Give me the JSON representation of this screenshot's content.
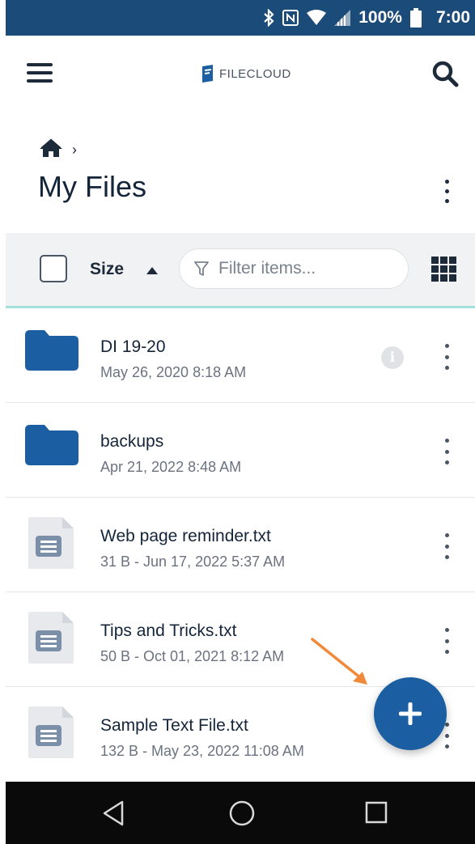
{
  "status_bar": {
    "battery_text": "100%",
    "time": "7:00",
    "icons": [
      "bluetooth-icon",
      "nfc-icon",
      "wifi-icon",
      "cell-signal-icon",
      "battery-icon"
    ]
  },
  "app_bar": {
    "logo_text": "FILECLOUD",
    "icons": [
      "menu-icon",
      "filecloud-logo-icon",
      "search-icon"
    ]
  },
  "breadcrumb": {
    "home_icon": "home-icon",
    "separator": "›"
  },
  "page": {
    "title": "My Files"
  },
  "toolbar": {
    "sort_label": "Size",
    "sort_direction": "ascending",
    "filter_placeholder": "Filter items...",
    "accent_color": "#a4e0da"
  },
  "files": [
    {
      "type": "folder",
      "name": "DI 19-20",
      "meta": "May 26, 2020 8:18 AM",
      "has_info": true
    },
    {
      "type": "folder",
      "name": "backups",
      "meta": "Apr 21, 2022 8:48 AM",
      "has_info": false
    },
    {
      "type": "file",
      "name": "Web page reminder.txt",
      "meta": "31 B - Jun 17, 2022 5:37 AM",
      "has_info": false
    },
    {
      "type": "file",
      "name": "Tips and Tricks.txt",
      "meta": "50 B - Oct 01, 2021 8:12 AM",
      "has_info": false
    },
    {
      "type": "file",
      "name": "Sample Text File.txt",
      "meta": "132 B - May 23, 2022 11:08 AM",
      "has_info": false
    }
  ],
  "info_glyph": "i",
  "fab": {
    "icon": "plus-icon",
    "color": "#1b5fa2"
  },
  "annotation": {
    "icon": "orange-arrow-icon",
    "color": "#f08a3a"
  },
  "nav_bar": {
    "icons": [
      "back-icon",
      "home-circle-icon",
      "recents-icon"
    ]
  },
  "colors": {
    "status_bar": "#1b4b79",
    "folder": "#1b5fa2",
    "file_icon": "#7b8fa8"
  }
}
